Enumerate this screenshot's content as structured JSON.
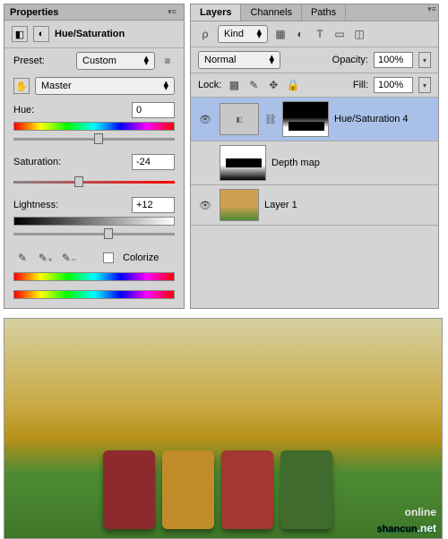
{
  "properties": {
    "title": "Properties",
    "adjustment_name": "Hue/Saturation",
    "preset_label": "Preset:",
    "preset_value": "Custom",
    "channel_value": "Master",
    "hue": {
      "label": "Hue:",
      "value": "0",
      "pos": 50
    },
    "saturation": {
      "label": "Saturation:",
      "value": "-24",
      "pos": 38
    },
    "lightness": {
      "label": "Lightness:",
      "value": "+12",
      "pos": 56
    },
    "colorize_label": "Colorize"
  },
  "layers": {
    "tabs": [
      "Layers",
      "Channels",
      "Paths"
    ],
    "kind_label": "Kind",
    "blend_value": "Normal",
    "opacity_label": "Opacity:",
    "opacity_value": "100%",
    "lock_label": "Lock:",
    "fill_label": "Fill:",
    "fill_value": "100%",
    "rows": [
      {
        "name": "Hue/Saturation 4",
        "visible": true,
        "selected": true,
        "type": "adj"
      },
      {
        "name": "Depth map",
        "visible": false,
        "selected": false,
        "type": "mask"
      },
      {
        "name": "Layer 1",
        "visible": true,
        "selected": false,
        "type": "image"
      }
    ]
  },
  "watermark": {
    "brand": "shancun",
    "domain": ".net",
    "label": "online"
  }
}
